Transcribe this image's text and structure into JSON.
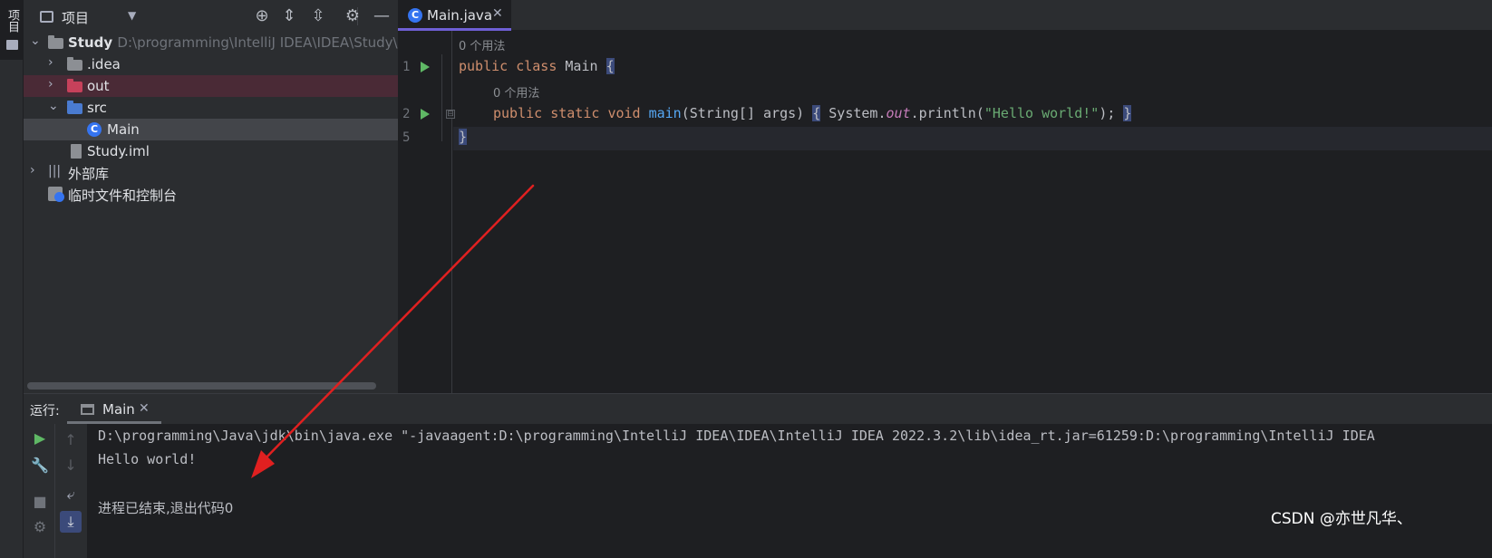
{
  "tool_strip": {
    "project_label": "项目"
  },
  "project_panel": {
    "title": "项目",
    "tree": {
      "root": {
        "name": "Study",
        "path": "D:\\programming\\IntelliJ IDEA\\IDEA\\Study\\Stu"
      },
      "idea": ".idea",
      "out": "out",
      "src": "src",
      "main": "Main",
      "iml": "Study.iml",
      "libraries": "外部库",
      "scratches": "临时文件和控制台"
    }
  },
  "editor": {
    "tab_label": "Main.java",
    "usage_hint_1": "0 个用法",
    "usage_hint_2": "0 个用法",
    "line_numbers": [
      "1",
      "2",
      "5"
    ],
    "code": {
      "l1_kw1": "public",
      "l1_kw2": "class",
      "l1_name": "Main",
      "l1_brace": "{",
      "l2_kw1": "public",
      "l2_kw2": "static",
      "l2_kw3": "void",
      "l2_method": "main",
      "l2_params": "(String[] args)",
      "l2_open": "{",
      "l2_sys": "System.",
      "l2_field": "out",
      "l2_call": ".println(",
      "l2_str": "\"Hello world!\"",
      "l2_end": ");",
      "l2_close": "}",
      "l5_brace": "}"
    }
  },
  "run_panel": {
    "label": "运行:",
    "tab_label": "Main",
    "console": [
      "D:\\programming\\Java\\jdk\\bin\\java.exe \"-javaagent:D:\\programming\\IntelliJ IDEA\\IDEA\\IntelliJ IDEA 2022.3.2\\lib\\idea_rt.jar=61259:D:\\programming\\IntelliJ IDEA",
      "Hello world!",
      "",
      "进程已结束,退出代码0"
    ]
  },
  "watermark": "CSDN @亦世凡华、",
  "colors": {
    "accent": "#6f5fd5",
    "keyword": "#cf8e6d",
    "method": "#56a8f5",
    "string": "#6aab73",
    "field": "#c77dbb",
    "run_green": "#5fb865",
    "arrow_red": "#e02020"
  }
}
